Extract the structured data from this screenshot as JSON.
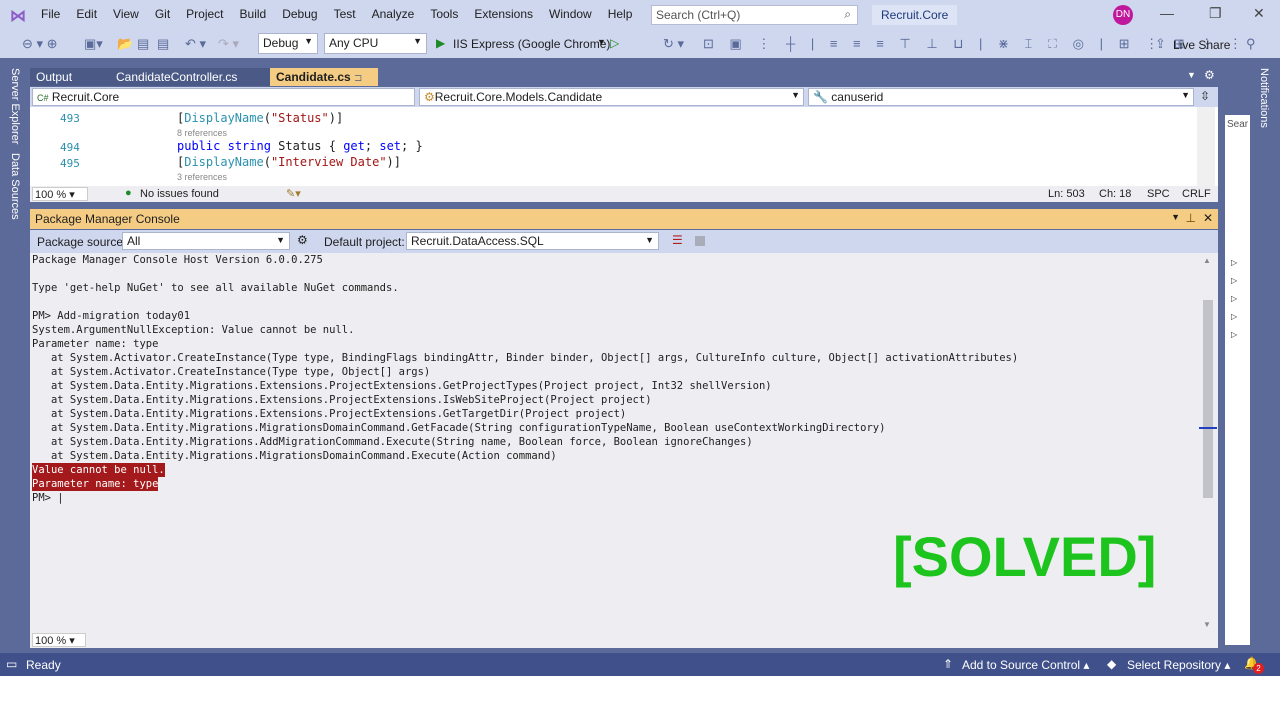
{
  "app": {
    "menu": [
      "File",
      "Edit",
      "View",
      "Git",
      "Project",
      "Build",
      "Debug",
      "Test",
      "Analyze",
      "Tools",
      "Extensions",
      "Window",
      "Help"
    ],
    "search_placeholder": "Search (Ctrl+Q)",
    "solution_name": "Recruit.Core",
    "avatar_initials": "DN"
  },
  "toolbar": {
    "configuration": "Debug",
    "platform": "Any CPU",
    "run_target": "IIS Express (Google Chrome)",
    "live_share": "Live Share"
  },
  "side_left": [
    "Server Explorer",
    "Data Sources"
  ],
  "side_right": "Notifications",
  "tabs": [
    {
      "label": "Output",
      "active": false
    },
    {
      "label": "CandidateController.cs",
      "active": false
    },
    {
      "label": "Candidate.cs",
      "active": true
    }
  ],
  "navbar": {
    "project": "Recruit.Core",
    "type": "Recruit.Core.Models.Candidate",
    "member": "canuserid"
  },
  "editor": {
    "lines": [
      {
        "num": "493",
        "pre": "[",
        "type": "DisplayName",
        "mid": "(",
        "str": "\"Status\"",
        "post": ")]"
      },
      {
        "refs": "8 references"
      },
      {
        "num": "494",
        "kw1": "public",
        "kw2": "string",
        "rest": " Status { ",
        "kw3": "get",
        "semi": "; ",
        "kw4": "set",
        "end": "; }"
      },
      {
        "num": "495",
        "pre": "[",
        "type": "DisplayName",
        "mid": "(",
        "str": "\"Interview Date\"",
        "post": ")]"
      },
      {
        "refs": "3 references"
      }
    ],
    "zoom": "100 %",
    "issues": "No issues found",
    "ln": "Ln: 503",
    "ch": "Ch: 18",
    "spc": "SPC",
    "crlf": "CRLF"
  },
  "pmc": {
    "title": "Package Manager Console",
    "package_source_label": "Package source:",
    "package_source": "All",
    "default_project_label": "Default project:",
    "default_project": "Recruit.DataAccess.SQL",
    "zoom": "100 %",
    "lines": [
      {
        "text": "Package Manager Console Host Version 6.0.0.275",
        "error": false
      },
      {
        "text": "",
        "error": false
      },
      {
        "text": "Type 'get-help NuGet' to see all available NuGet commands.",
        "error": false
      },
      {
        "text": "",
        "error": false
      },
      {
        "text": "PM> Add-migration today01",
        "error": false
      },
      {
        "text": "System.ArgumentNullException: Value cannot be null.",
        "error": false
      },
      {
        "text": "Parameter name: type",
        "error": false
      },
      {
        "text": "   at System.Activator.CreateInstance(Type type, BindingFlags bindingAttr, Binder binder, Object[] args, CultureInfo culture, Object[] activationAttributes)",
        "error": false
      },
      {
        "text": "   at System.Activator.CreateInstance(Type type, Object[] args)",
        "error": false
      },
      {
        "text": "   at System.Data.Entity.Migrations.Extensions.ProjectExtensions.GetProjectTypes(Project project, Int32 shellVersion)",
        "error": false
      },
      {
        "text": "   at System.Data.Entity.Migrations.Extensions.ProjectExtensions.IsWebSiteProject(Project project)",
        "error": false
      },
      {
        "text": "   at System.Data.Entity.Migrations.Extensions.ProjectExtensions.GetTargetDir(Project project)",
        "error": false
      },
      {
        "text": "   at System.Data.Entity.Migrations.MigrationsDomainCommand.GetFacade(String configurationTypeName, Boolean useContextWorkingDirectory)",
        "error": false
      },
      {
        "text": "   at System.Data.Entity.Migrations.AddMigrationCommand.Execute(String name, Boolean force, Boolean ignoreChanges)",
        "error": false
      },
      {
        "text": "   at System.Data.Entity.Migrations.MigrationsDomainCommand.Execute(Action command)",
        "error": false
      },
      {
        "text": "Value cannot be null.",
        "error": true
      },
      {
        "text": "Parameter name: type",
        "error": true
      },
      {
        "text": "PM> |",
        "error": false
      }
    ]
  },
  "overlay": {
    "text": "[SOLVED]",
    "color": "#1ec41e"
  },
  "statusbar": {
    "ready": "Ready",
    "source_control": "Add to Source Control",
    "repository": "Select Repository",
    "notification_count": "2"
  }
}
